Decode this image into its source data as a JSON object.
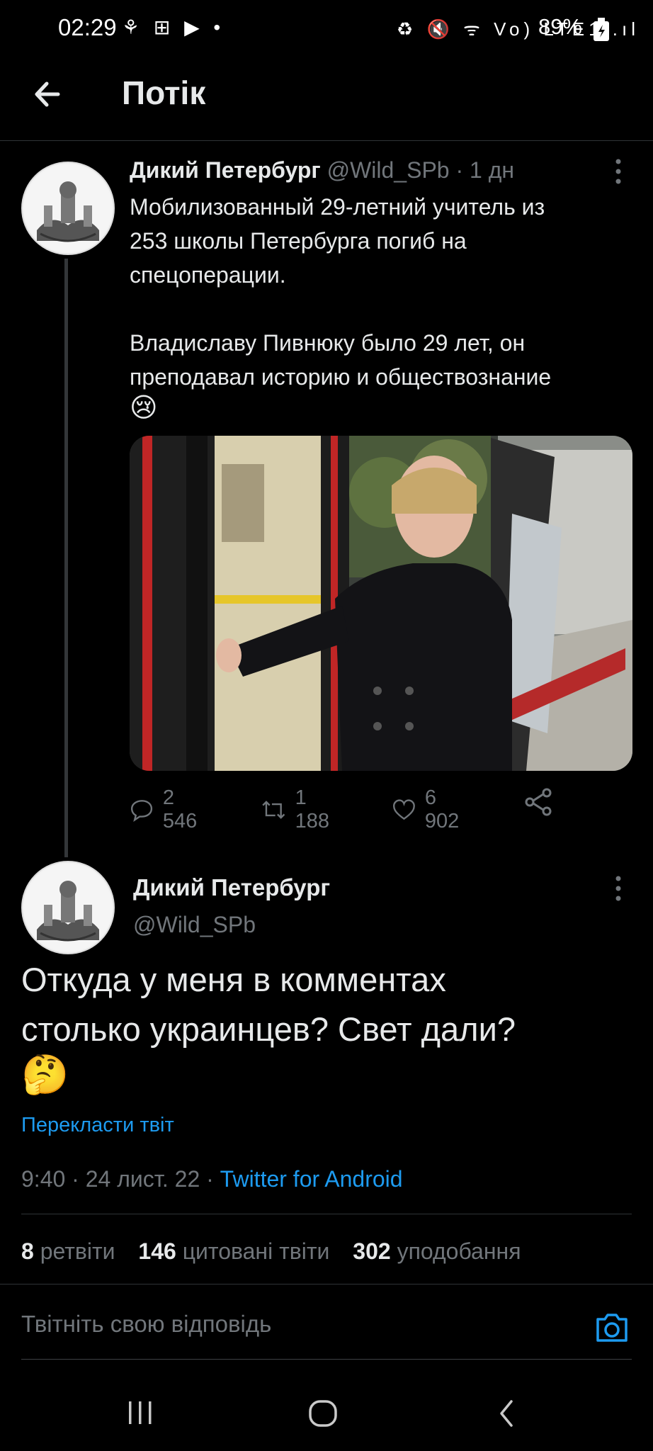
{
  "status_bar": {
    "time": "02:29",
    "left_icons": "⚘ ⊞ ▶ •",
    "right_icons": "♻ 🔇 ᯤ Vo) LTE1 .ıl",
    "battery": "89%"
  },
  "header": {
    "title": "Потік"
  },
  "tweet1": {
    "author_name": "Дикий Петербург",
    "author_handle": "@Wild_SPb",
    "time_sep": " · ",
    "age": "1 дн",
    "text": "Мобилизованный 29-летний учитель из\n253 школы Петербурга погиб на\nспецоперации.\n\nВладиславу Пивнюку было 29 лет, он\nпреподавал историю и обществознание",
    "emoji": "😢",
    "replies": "2 546",
    "retweets": "1 188",
    "likes": "6 902"
  },
  "tweet2": {
    "author_name": "Дикий Петербург",
    "author_handle": "@Wild_SPb",
    "text": "Откуда у меня в комментах\nстолько украинцев? Свет дали?",
    "emoji": "🤔",
    "translate_link": "Перекласти твіт",
    "timestamp": "9:40 · 24 лист. 22 · ",
    "source": "Twitter for Android",
    "retweets_count": "8",
    "retweets_label": " ретвіти",
    "quotes_count": "146",
    "quotes_label": " цитовані твіти",
    "likes_count": "302",
    "likes_label": " уподобання"
  },
  "reply_box": {
    "placeholder": "Твітніть свою відповідь"
  },
  "colors": {
    "accent": "#1d9bf0",
    "background": "#000000",
    "muted": "#71767b"
  }
}
